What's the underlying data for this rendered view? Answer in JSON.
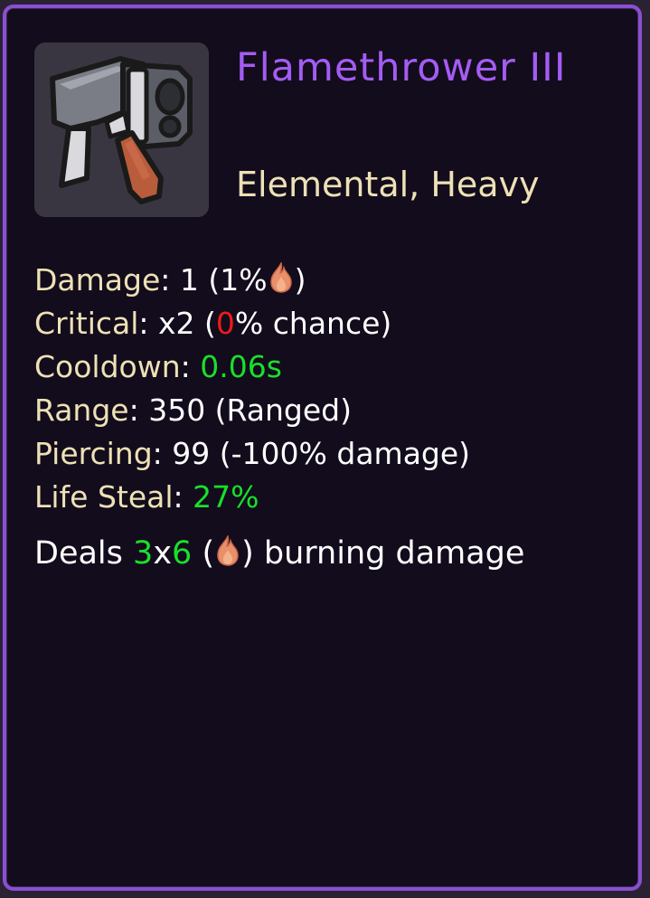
{
  "item": {
    "name": "Flamethrower III",
    "tags": "Elemental, Heavy",
    "icon": "flamethrower-icon"
  },
  "stats": {
    "damage": {
      "label": "Damage",
      "sep": ": ",
      "value": "1 (1%",
      "close": ")"
    },
    "critical": {
      "label": "Critical",
      "sep": ": ",
      "pre": "x2 (",
      "chance": "0",
      "post": "% chance)"
    },
    "cooldown": {
      "label": "Cooldown",
      "sep": ": ",
      "value": "0.06s"
    },
    "range": {
      "label": "Range",
      "sep": ": ",
      "value": "350 (Ranged)"
    },
    "piercing": {
      "label": "Piercing",
      "sep": ": ",
      "value": "99 (-100% damage)"
    },
    "life_steal": {
      "label": "Life Steal",
      "sep": ": ",
      "value": "27%"
    }
  },
  "effect": {
    "pre": "Deals ",
    "ticks_damage": "3",
    "x": "x",
    "ticks": "6",
    "open": " (",
    "post": ") burning damage",
    "icon": "flame-icon"
  },
  "colors": {
    "title": "#a45cf4",
    "label": "#ede1b6",
    "positive": "#18e02a",
    "negative": "#ee1b1b",
    "border": "#8a4fd2",
    "background": "#130c1c"
  }
}
